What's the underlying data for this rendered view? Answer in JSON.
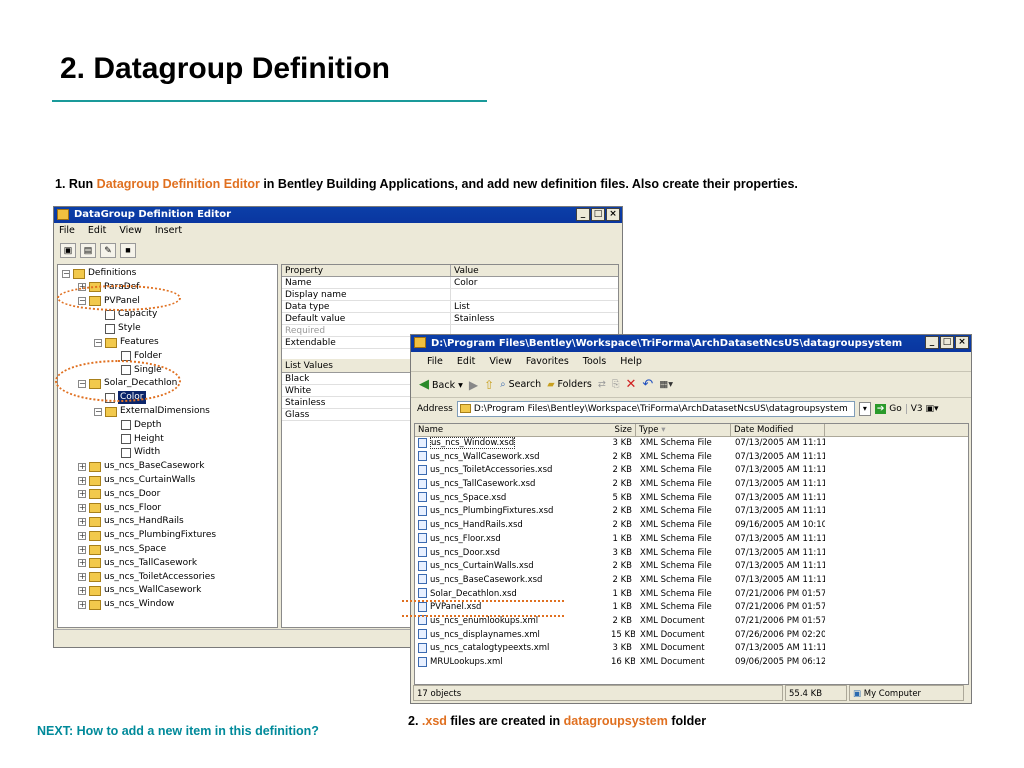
{
  "slide": {
    "title": "2. Datagroup Definition",
    "instruction": {
      "prefix": "1. Run ",
      "highlight": "Datagroup Definition Editor",
      "suffix": " in Bentley Building Applications, and add new definition files. Also create their properties."
    },
    "caption": {
      "prefix": "2. ",
      "highlight1": ".xsd",
      "middle": " files are created in ",
      "highlight2": "datagroupsystem",
      "suffix": " folder"
    },
    "next": "NEXT: How to add a new item in this definition?"
  },
  "editor": {
    "title": "DataGroup Definition Editor",
    "menu": [
      "File",
      "Edit",
      "View",
      "Insert"
    ],
    "tree": [
      {
        "label": "Definitions",
        "icon": "folder-icon",
        "exp": "-"
      },
      {
        "label": "ParaDef",
        "icon": "datagroup-icon",
        "exp": "+"
      },
      {
        "label": "PVPanel",
        "icon": "datagroup-icon",
        "exp": "-"
      },
      {
        "label": "Capacity",
        "icon": "property-icon",
        "exp": ""
      },
      {
        "label": "Style",
        "icon": "property-icon",
        "exp": ""
      },
      {
        "label": "Features",
        "icon": "datagroup-icon",
        "exp": "-"
      },
      {
        "label": "Folder",
        "icon": "property-icon",
        "exp": ""
      },
      {
        "label": "Single",
        "icon": "property-icon",
        "exp": ""
      },
      {
        "label": "Solar_Decathlon",
        "icon": "datagroup-icon",
        "exp": "-"
      },
      {
        "label": "Color",
        "icon": "property-icon",
        "exp": "",
        "selected": true
      },
      {
        "label": "ExternalDimensions",
        "icon": "datagroup-icon",
        "exp": "-"
      },
      {
        "label": "Depth",
        "icon": "property-icon",
        "exp": ""
      },
      {
        "label": "Height",
        "icon": "property-icon",
        "exp": ""
      },
      {
        "label": "Width",
        "icon": "property-icon",
        "exp": ""
      },
      {
        "label": "us_ncs_BaseCasework",
        "icon": "datagroup-icon",
        "exp": "+"
      },
      {
        "label": "us_ncs_CurtainWalls",
        "icon": "datagroup-icon",
        "exp": "+"
      },
      {
        "label": "us_ncs_Door",
        "icon": "datagroup-icon",
        "exp": "+"
      },
      {
        "label": "us_ncs_Floor",
        "icon": "datagroup-icon",
        "exp": "+"
      },
      {
        "label": "us_ncs_HandRails",
        "icon": "datagroup-icon",
        "exp": "+"
      },
      {
        "label": "us_ncs_PlumbingFixtures",
        "icon": "datagroup-icon",
        "exp": "+"
      },
      {
        "label": "us_ncs_Space",
        "icon": "datagroup-icon",
        "exp": "+"
      },
      {
        "label": "us_ncs_TallCasework",
        "icon": "datagroup-icon",
        "exp": "+"
      },
      {
        "label": "us_ncs_ToiletAccessories",
        "icon": "datagroup-icon",
        "exp": "+"
      },
      {
        "label": "us_ncs_WallCasework",
        "icon": "datagroup-icon",
        "exp": "+"
      },
      {
        "label": "us_ncs_Window",
        "icon": "datagroup-icon",
        "exp": "+"
      }
    ],
    "props": {
      "headers": [
        "Property",
        "Value"
      ],
      "rows": [
        [
          "Name",
          "Color"
        ],
        [
          "Display name",
          ""
        ],
        [
          "Data type",
          "List"
        ],
        [
          "Default value",
          "Stainless"
        ],
        [
          "Required",
          ""
        ],
        [
          "Extendable",
          ""
        ]
      ]
    },
    "list_values": {
      "header": "List Values",
      "items": [
        "Black",
        "White",
        "Stainless",
        "Glass"
      ]
    }
  },
  "explorer": {
    "title": "D:\\Program Files\\Bentley\\Workspace\\TriForma\\ArchDatasetNcsUS\\datagroupsystem",
    "menu": [
      "File",
      "Edit",
      "View",
      "Favorites",
      "Tools",
      "Help"
    ],
    "toolbar": {
      "back": "Back",
      "search": "Search",
      "folders": "Folders"
    },
    "address": {
      "label": "Address",
      "value": "D:\\Program Files\\Bentley\\Workspace\\TriForma\\ArchDatasetNcsUS\\datagroupsystem",
      "go": "Go",
      "extra": "V3"
    },
    "columns": [
      "Name",
      "Size",
      "Type",
      "Date Modified"
    ],
    "files": [
      [
        "us_ncs_Window.xsd",
        "3 KB",
        "XML Schema File",
        "07/13/2005 AM 11:11"
      ],
      [
        "us_ncs_WallCasework.xsd",
        "2 KB",
        "XML Schema File",
        "07/13/2005 AM 11:11"
      ],
      [
        "us_ncs_ToiletAccessories.xsd",
        "2 KB",
        "XML Schema File",
        "07/13/2005 AM 11:11"
      ],
      [
        "us_ncs_TallCasework.xsd",
        "2 KB",
        "XML Schema File",
        "07/13/2005 AM 11:11"
      ],
      [
        "us_ncs_Space.xsd",
        "5 KB",
        "XML Schema File",
        "07/13/2005 AM 11:11"
      ],
      [
        "us_ncs_PlumbingFixtures.xsd",
        "2 KB",
        "XML Schema File",
        "07/13/2005 AM 11:11"
      ],
      [
        "us_ncs_HandRails.xsd",
        "2 KB",
        "XML Schema File",
        "09/16/2005 AM 10:10"
      ],
      [
        "us_ncs_Floor.xsd",
        "1 KB",
        "XML Schema File",
        "07/13/2005 AM 11:11"
      ],
      [
        "us_ncs_Door.xsd",
        "3 KB",
        "XML Schema File",
        "07/13/2005 AM 11:11"
      ],
      [
        "us_ncs_CurtainWalls.xsd",
        "2 KB",
        "XML Schema File",
        "07/13/2005 AM 11:11"
      ],
      [
        "us_ncs_BaseCasework.xsd",
        "2 KB",
        "XML Schema File",
        "07/13/2005 AM 11:11"
      ],
      [
        "Solar_Decathlon.xsd",
        "1 KB",
        "XML Schema File",
        "07/21/2006 PM 01:57"
      ],
      [
        "PVPanel.xsd",
        "1 KB",
        "XML Schema File",
        "07/21/2006 PM 01:57"
      ],
      [
        "us_ncs_enumlookups.xml",
        "2 KB",
        "XML Document",
        "07/21/2006 PM 01:57"
      ],
      [
        "us_ncs_displaynames.xml",
        "15 KB",
        "XML Document",
        "07/26/2006 PM 02:20"
      ],
      [
        "us_ncs_catalogtypeexts.xml",
        "3 KB",
        "XML Document",
        "07/13/2005 AM 11:11"
      ],
      [
        "MRULookups.xml",
        "16 KB",
        "XML Document",
        "09/06/2005 PM 06:12"
      ]
    ],
    "status": {
      "count": "17 objects",
      "size": "55.4 KB",
      "location": "My Computer"
    }
  },
  "colors": {
    "accent": "#e07020",
    "rule": "#1a9a9a",
    "next": "#008a9a",
    "titlebar": "#0a36a0"
  }
}
